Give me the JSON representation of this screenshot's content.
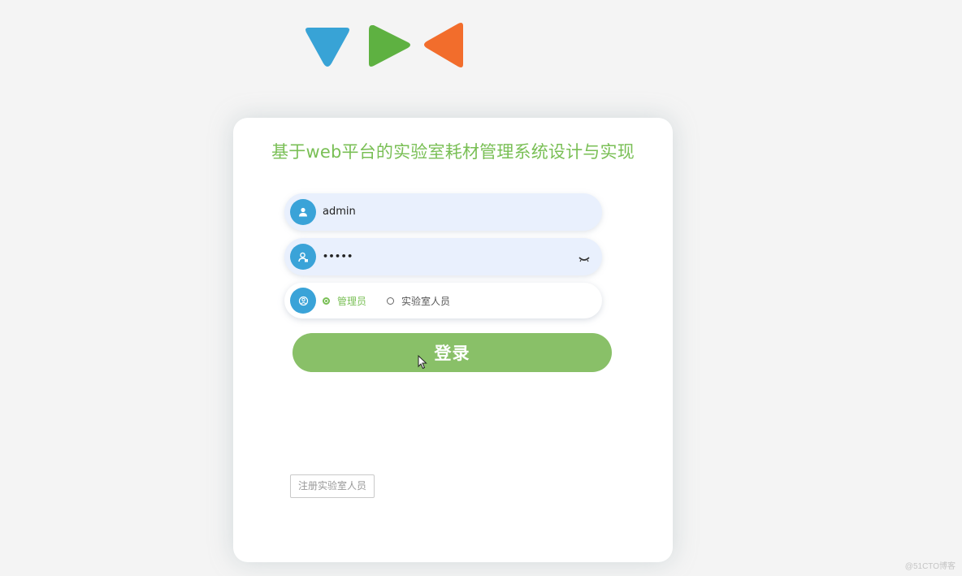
{
  "header": {
    "logo_colors": [
      "#38a3d6",
      "#5eb141",
      "#f26d2c"
    ]
  },
  "login_card": {
    "title": "基于web平台的实验室耗材管理系统设计与实现",
    "username": {
      "value": "admin",
      "icon": "user-icon"
    },
    "password": {
      "value": "•••••",
      "icon": "lock-user-icon",
      "toggle_icon": "eye-closed-icon"
    },
    "role": {
      "icon": "role-icon",
      "options": [
        {
          "label": "管理员",
          "checked": true
        },
        {
          "label": "实验室人员",
          "checked": false
        }
      ]
    },
    "login_label": "登录",
    "register_label": "注册实验室人员"
  },
  "footer": {
    "watermark": "@51CTO博客"
  },
  "colors": {
    "accent_green": "#79bf55",
    "button_green": "#89c068",
    "icon_blue": "#3aa3d8",
    "input_bg": "#e9f0fd"
  }
}
